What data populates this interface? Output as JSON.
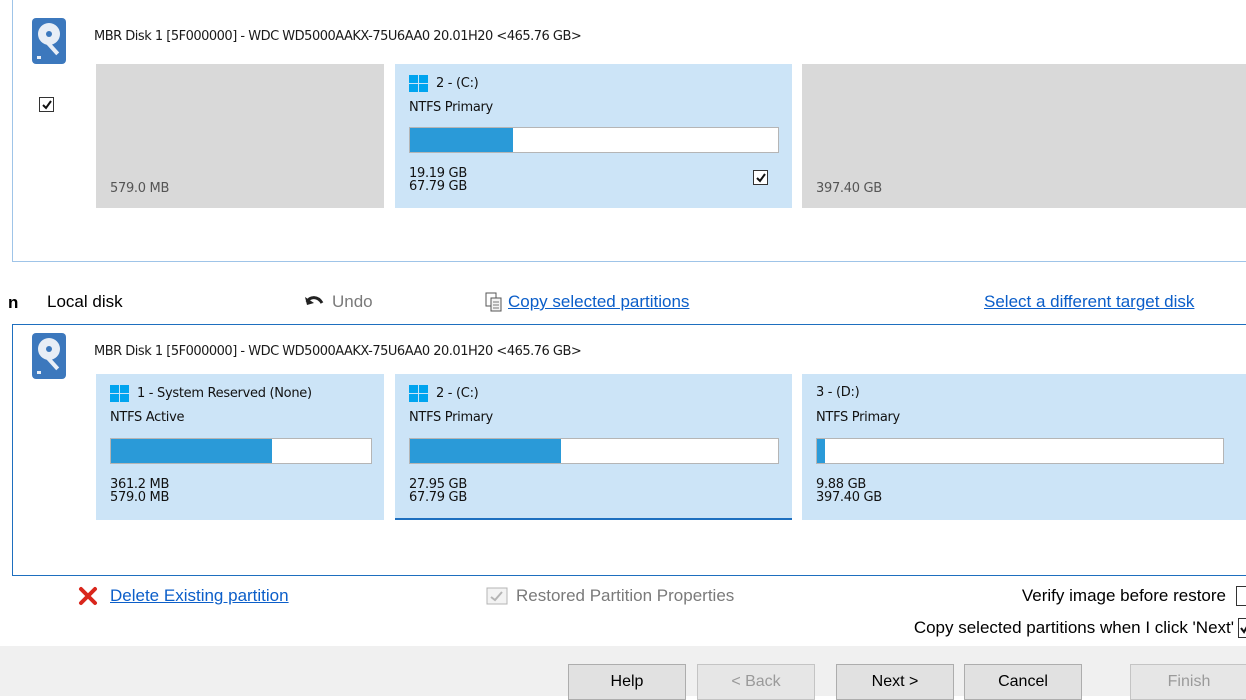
{
  "source_disk": {
    "title": "MBR Disk 1 [5F000000] - WDC WD5000AAKX-75U6AA0 20.01H20  <465.76 GB>",
    "disk_checked": true,
    "partitions": [
      {
        "size": "579.0 MB"
      },
      {
        "label": "2 - (C:)",
        "type": "NTFS Primary",
        "used": "19.19 GB",
        "total": "67.79 GB",
        "used_fraction": 0.28,
        "checked": true
      },
      {
        "size": "397.40 GB"
      }
    ]
  },
  "toolbar": {
    "left_cut_text": "n",
    "local_disk": "Local disk",
    "undo": "Undo",
    "copy_selected": "Copy selected partitions",
    "select_target": "Select a different target disk"
  },
  "target_disk": {
    "title": "MBR Disk 1 [5F000000] - WDC WD5000AAKX-75U6AA0 20.01H20  <465.76 GB>",
    "partitions": [
      {
        "label": "1 - System Reserved (None)",
        "type": "NTFS Active",
        "used": "361.2 MB",
        "total": "579.0 MB",
        "used_fraction": 0.62
      },
      {
        "label": "2 - (C:)",
        "type": "NTFS Primary",
        "used": "27.95 GB",
        "total": "67.79 GB",
        "used_fraction": 0.41
      },
      {
        "label": "3 - (D:)",
        "type": "NTFS Primary",
        "used": "9.88 GB",
        "total": "397.40 GB",
        "used_fraction": 0.02
      }
    ]
  },
  "actions": {
    "delete_existing": "Delete Existing partition",
    "restored_props": "Restored Partition Properties",
    "verify": "Verify image before restore",
    "copy_on_next": "Copy selected partitions when I click 'Next'"
  },
  "buttons": {
    "help": "Help",
    "back": "< Back",
    "next": "Next >",
    "cancel": "Cancel",
    "finish": "Finish"
  },
  "colors": {
    "accent": "#2a9ad8",
    "partition_selected": "#cce4f7",
    "partition_unallocated": "#d9d9d9",
    "link": "#0b5ec9",
    "delete_red": "#d9261c"
  }
}
